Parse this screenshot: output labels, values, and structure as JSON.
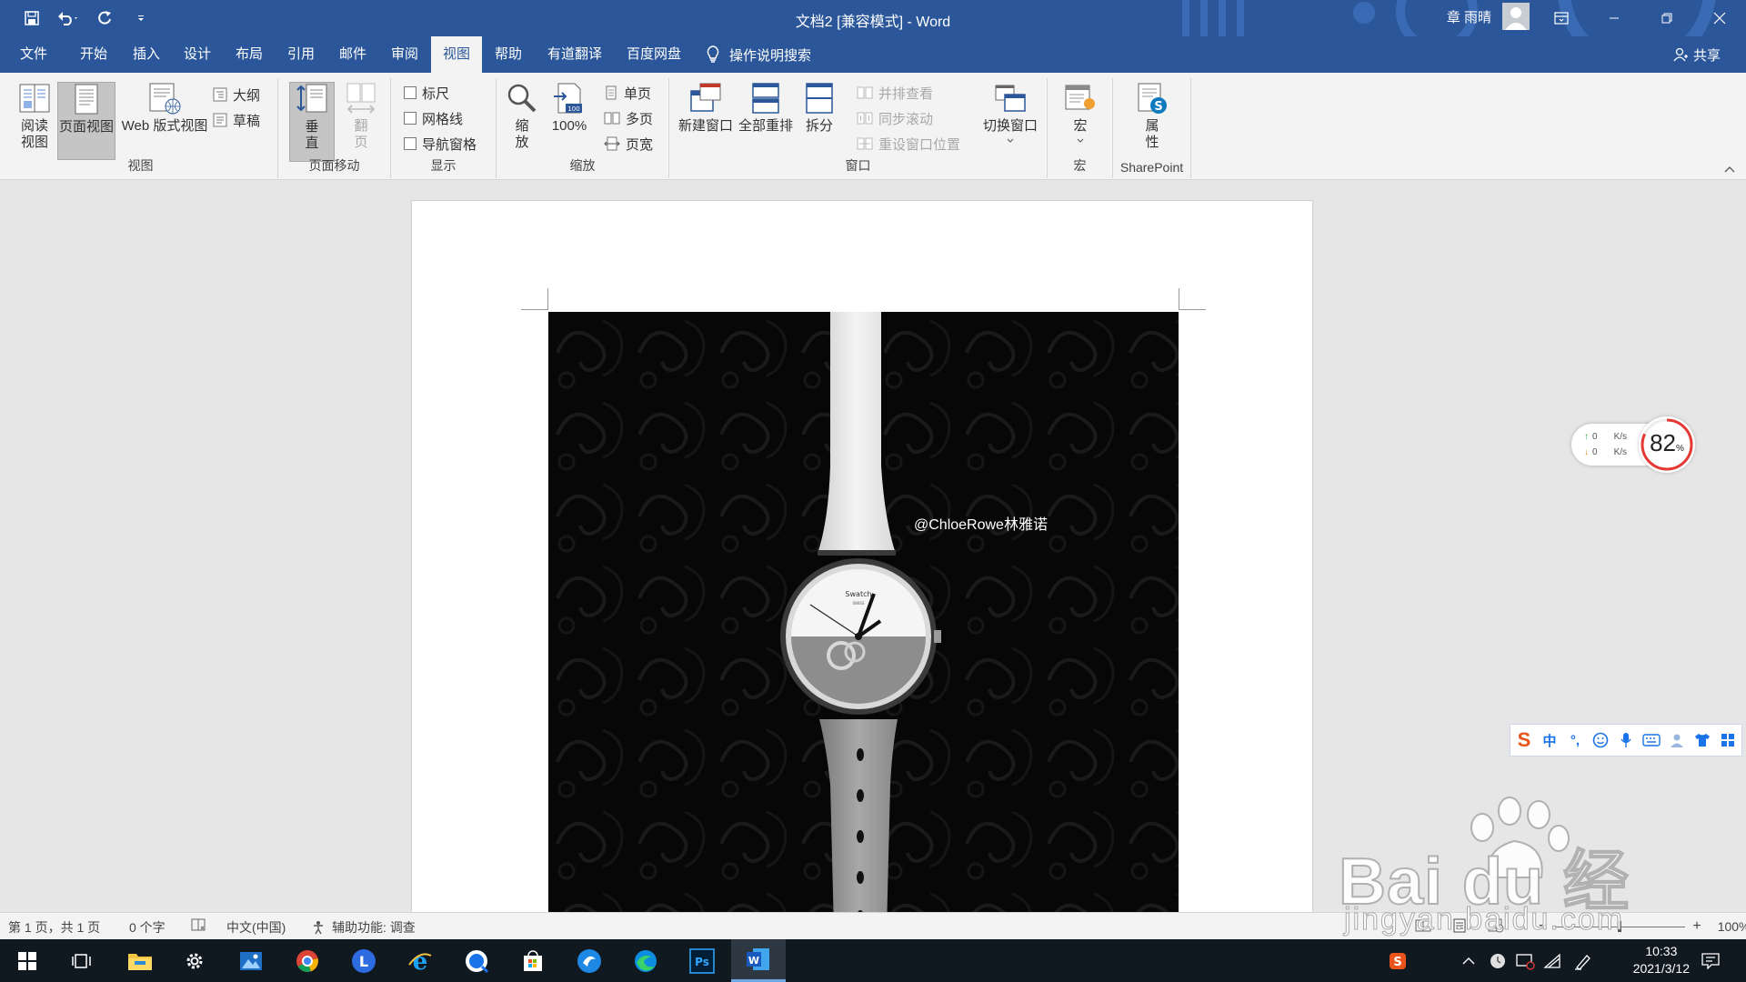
{
  "window": {
    "title": "文档2 [兼容模式] - Word",
    "user_name": "章 雨晴"
  },
  "tabs": [
    "文件",
    "开始",
    "插入",
    "设计",
    "布局",
    "引用",
    "邮件",
    "审阅",
    "视图",
    "帮助",
    "有道翻译",
    "百度网盘"
  ],
  "active_tab": "视图",
  "tell_me": "操作说明搜索",
  "share": "共享",
  "ribbon": {
    "views": {
      "label": "视图",
      "read_mode": "阅读\n视图",
      "print_layout": "页面视图",
      "web_layout": "Web 版式视图",
      "outline": "大纲",
      "draft": "草稿"
    },
    "page_movement": {
      "label": "页面移动",
      "vertical": "垂\n直",
      "side_to_side": "翻\n页"
    },
    "show": {
      "label": "显示",
      "ruler": "标尺",
      "gridlines": "网格线",
      "nav_pane": "导航窗格"
    },
    "zoom": {
      "label": "缩放",
      "zoom": "缩\n放",
      "hundred": "100%",
      "one_page": "单页",
      "multi_page": "多页",
      "page_width": "页宽"
    },
    "window": {
      "label": "窗口",
      "new_window": "新建窗口",
      "arrange_all": "全部重排",
      "split": "拆分",
      "side_by_side": "并排查看",
      "sync_scroll": "同步滚动",
      "reset_position": "重设窗口位置",
      "switch_windows": "切换窗口"
    },
    "macros": {
      "label": "宏",
      "macros": "宏"
    },
    "sharepoint": {
      "label": "SharePoint",
      "properties": "属\n性"
    }
  },
  "document": {
    "image_handle": "@ChloeRowe林雅诺",
    "watch_brand": "Swatch",
    "watch_sub": "SWISS"
  },
  "net_widget": {
    "up": "0",
    "down": "0",
    "unit": "K/s",
    "percent": "82",
    "percent_sign": "%"
  },
  "ime": {
    "mode": "中",
    "punct": "°,"
  },
  "watermark": {
    "main": "Bai du 经验",
    "sub": "jingyan.baidu.com"
  },
  "status": {
    "page": "第 1 页，共 1 页",
    "words": "0 个字",
    "language": "中文(中国)",
    "accessibility": "辅助功能: 调查",
    "zoom": "100%"
  },
  "taskbar": {
    "time": "10:33",
    "date": "2021/3/12",
    "ps_label": "Ps",
    "word_label": "W"
  },
  "colors": {
    "word_blue": "#2b579a",
    "ribbon_bg": "#f3f3f3",
    "taskbar_bg": "#101820"
  }
}
